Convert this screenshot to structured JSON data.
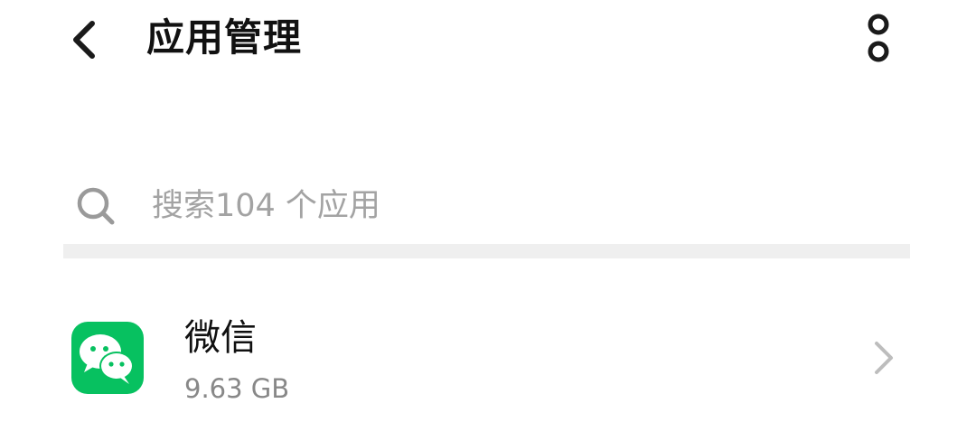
{
  "header": {
    "title": "应用管理",
    "back_icon": "chevron-left-icon",
    "more_icon": "more-vertical-icon"
  },
  "search": {
    "placeholder": "搜索104 个应用",
    "icon": "search-icon"
  },
  "apps": [
    {
      "name": "微信",
      "size": "9.63 GB",
      "icon": "wechat-icon",
      "icon_color": "#07c160"
    }
  ],
  "colors": {
    "accent": "#07c160",
    "divider": "#efefef",
    "placeholder": "#a3a3a3",
    "secondary_text": "#888888"
  }
}
